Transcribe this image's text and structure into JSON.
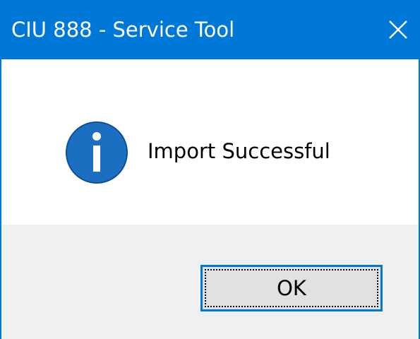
{
  "window": {
    "title": "CIU 888 - Service Tool",
    "close_icon": "close-icon"
  },
  "message": {
    "icon": "info-icon",
    "text": "Import Successful"
  },
  "buttons": {
    "ok_label": "OK"
  },
  "colors": {
    "titlebar": "#0078d7",
    "icon_blue": "#1b6fc0",
    "footer": "#f0f0f0",
    "button_face": "#e1e1e1"
  }
}
